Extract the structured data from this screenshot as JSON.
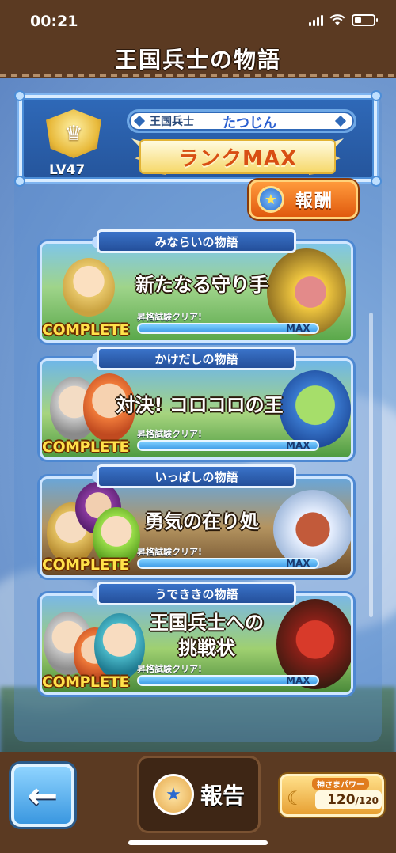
{
  "status_bar": {
    "time": "00:21"
  },
  "header": {
    "title": "王国兵士の物語"
  },
  "profile": {
    "level": "LV47",
    "class": "王国兵士",
    "name": "たつじん",
    "rank": "ランクMAX",
    "reward_label": "報酬"
  },
  "stories": [
    {
      "tab": "みならいの物語",
      "headline": "新たなる守り手",
      "progress_text": "昇格試験クリア!",
      "max": "MAX",
      "status": "COMPLETE"
    },
    {
      "tab": "かけだしの物語",
      "headline": "対決! コロコロの王",
      "progress_text": "昇格試験クリア!",
      "max": "MAX",
      "status": "COMPLETE"
    },
    {
      "tab": "いっぱしの物語",
      "headline": "勇気の在り処",
      "progress_text": "昇格試験クリア!",
      "max": "MAX",
      "status": "COMPLETE"
    },
    {
      "tab": "うでききの物語",
      "headline": "王国兵士への挑戦状",
      "headline_line1": "王国兵士への",
      "headline_line2": "挑戦状",
      "progress_text": "昇格試験クリア!",
      "max": "MAX",
      "status": "COMPLETE"
    }
  ],
  "bottom": {
    "back_icon": "←",
    "report_label": "報告",
    "power_caption": "神さまパワー",
    "power_current": "120",
    "power_max": "/120"
  },
  "colors": {
    "accent": "#2f69b8",
    "header_bg": "#5b3a22",
    "complete": "#ffe24a"
  }
}
